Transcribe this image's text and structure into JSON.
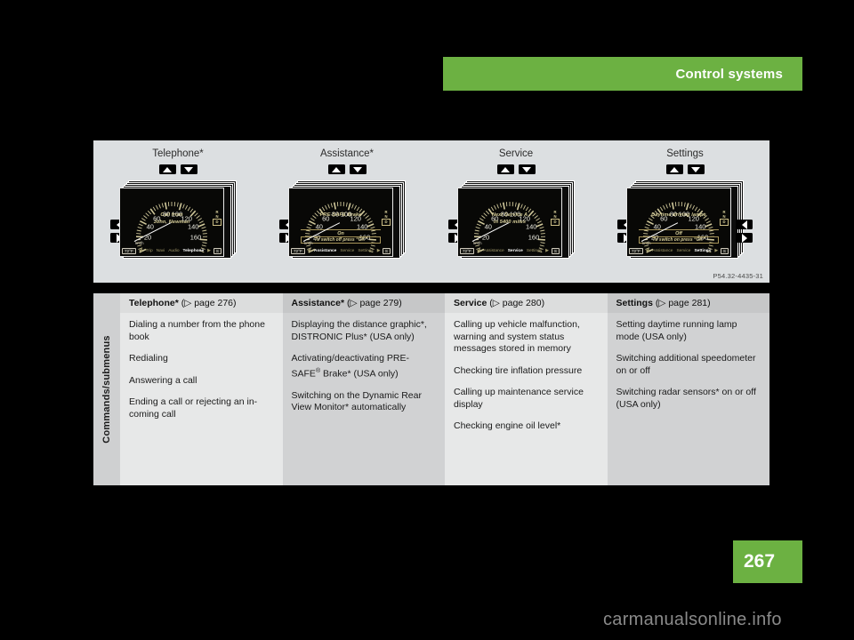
{
  "header": {
    "title": "Control systems",
    "accent_color": "#6cb142"
  },
  "figure": {
    "reference": "P54.32-4435-31",
    "background_color": "#dcdfe1",
    "nav_icons": {
      "up": "triangle-up-icon",
      "down": "triangle-down-icon",
      "left": "triangle-left-icon",
      "right": "triangle-right-icon"
    },
    "clusters": [
      {
        "title": "Telephone*",
        "display": {
          "message_line1": "Call from",
          "message_line2": "John, Newman",
          "sub_line": "",
          "sub_boxed": "",
          "temperature": "72°F",
          "gear_selected": "S",
          "gear_labels": [
            "R",
            "N",
            "D"
          ],
          "park_label": "P",
          "unit_label": "km/h",
          "menu": [
            "Trip",
            "Navi",
            "Audio",
            "Telephone"
          ],
          "menu_selected": "Telephone",
          "dial_ticks": [
            "20",
            "40",
            "60",
            "80",
            "100",
            "120",
            "140",
            "160"
          ]
        }
      },
      {
        "title": "Assistance*",
        "display": {
          "message_line1": "PRE-SAFE Brake",
          "message_line2": "",
          "sub_line": "On",
          "sub_boxed": "To switch off press “OK”",
          "temperature": "72°F",
          "gear_selected": "S",
          "gear_labels": [
            "R",
            "N",
            "D"
          ],
          "park_label": "P",
          "unit_label": "km/h",
          "menu": [
            "Assistance",
            "Service",
            "Settings"
          ],
          "menu_selected": "Assistance",
          "dial_ticks": [
            "20",
            "40",
            "60",
            "80",
            "100",
            "120",
            "140",
            "160"
          ]
        }
      },
      {
        "title": "Service",
        "display": {
          "message_line1": "Next Service A",
          "message_line2": "in 5400 miles",
          "sub_line": "",
          "sub_boxed": "",
          "temperature": "72°F",
          "gear_selected": "S",
          "gear_labels": [
            "R",
            "N",
            "D"
          ],
          "park_label": "P",
          "unit_label": "km/h",
          "menu": [
            "Assistance",
            "Service",
            "Settings"
          ],
          "menu_selected": "Service",
          "dial_ticks": [
            "20",
            "40",
            "60",
            "80",
            "100",
            "120",
            "140",
            "160"
          ]
        }
      },
      {
        "title": "Settings",
        "display": {
          "message_line1": "Daytime driving lamps",
          "message_line2": "",
          "sub_line": "Off",
          "sub_boxed": "To switch on press “OK”",
          "temperature": "72°F",
          "gear_selected": "S",
          "gear_labels": [
            "R",
            "N",
            "D"
          ],
          "park_label": "P",
          "unit_label": "km/h",
          "menu": [
            "Assistance",
            "Service",
            "Settings"
          ],
          "menu_selected": "Settings",
          "dial_ticks": [
            "20",
            "40",
            "60",
            "80",
            "100",
            "120",
            "140",
            "160"
          ]
        }
      }
    ]
  },
  "table": {
    "row_label": "Commands/submenus",
    "columns": [
      {
        "name": "Telephone",
        "name_suffix": "*",
        "page_ref": "(▷ page 276)",
        "items": [
          "Dialing a number from the phone book",
          "Redialing",
          "Answering a call",
          "Ending a call or rejecting an in-coming call"
        ]
      },
      {
        "name": "Assistance",
        "name_suffix": "*",
        "page_ref": "(▷ page 279)",
        "items": [
          "Displaying the distance graphic*, DISTRONIC Plus* (USA only)",
          "Activating/deactivating PRE-SAFE® Brake* (USA only)",
          "Switching on the Dynamic Rear View Monitor* automatically"
        ]
      },
      {
        "name": "Service",
        "name_suffix": "",
        "page_ref": "(▷ page 280)",
        "items": [
          "Calling up vehicle malfunction, warning and system status messages stored in memory",
          "Checking tire inflation pressure",
          "Calling up maintenance service display",
          "Checking engine oil level*"
        ]
      },
      {
        "name": "Settings",
        "name_suffix": "",
        "page_ref": "(▷ page 281)",
        "items": [
          "Setting daytime running lamp mode (USA only)",
          "Switching additional speedometer on or off",
          "Switching radar sensors* on or off (USA only)"
        ]
      }
    ]
  },
  "footer": {
    "page_number": "267",
    "watermark": "carmanualsonline.info"
  }
}
